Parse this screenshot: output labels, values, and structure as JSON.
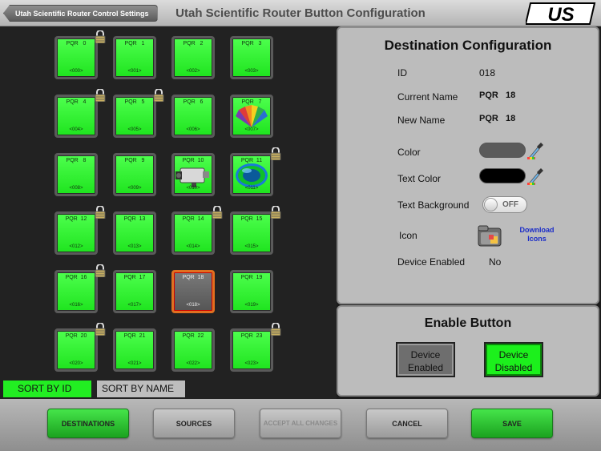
{
  "header": {
    "back_label": "Utah Scientific Router Control Settings",
    "title": "Utah Scientific Router Button Configuration",
    "logo_text": "US"
  },
  "tiles": [
    {
      "name": "PQR   0",
      "id": "<000>",
      "locked": true
    },
    {
      "name": "PQR   1",
      "id": "<001>",
      "locked": false
    },
    {
      "name": "PQR   2",
      "id": "<002>",
      "locked": false
    },
    {
      "name": "PQR   3",
      "id": "<003>",
      "locked": false
    },
    {
      "name": "PQR   4",
      "id": "<004>",
      "locked": true
    },
    {
      "name": "PQR   5",
      "id": "<005>",
      "locked": true
    },
    {
      "name": "PQR   6",
      "id": "<006>",
      "locked": false
    },
    {
      "name": "PQR   7",
      "id": "<007>",
      "locked": false,
      "icon": "peacock-logo-icon"
    },
    {
      "name": "PQR   8",
      "id": "<008>",
      "locked": false
    },
    {
      "name": "PQR   9",
      "id": "<009>",
      "locked": false
    },
    {
      "name": "PQR  10",
      "id": "<010>",
      "locked": false,
      "icon": "camera-icon"
    },
    {
      "name": "PQR  11",
      "id": "<011>",
      "locked": true,
      "icon": "globe-icon"
    },
    {
      "name": "PQR  12",
      "id": "<012>",
      "locked": true
    },
    {
      "name": "PQR  13",
      "id": "<013>",
      "locked": false
    },
    {
      "name": "PQR  14",
      "id": "<014>",
      "locked": true
    },
    {
      "name": "PQR  15",
      "id": "<015>",
      "locked": true
    },
    {
      "name": "PQR  16",
      "id": "<016>",
      "locked": true
    },
    {
      "name": "PQR  17",
      "id": "<017>",
      "locked": false
    },
    {
      "name": "PQR  18",
      "id": "<018>",
      "locked": false,
      "selected": true
    },
    {
      "name": "PQR  19",
      "id": "<019>",
      "locked": false
    },
    {
      "name": "PQR  20",
      "id": "<020>",
      "locked": true
    },
    {
      "name": "PQR  21",
      "id": "<021>",
      "locked": false
    },
    {
      "name": "PQR  22",
      "id": "<022>",
      "locked": false
    },
    {
      "name": "PQR  23",
      "id": "<023>",
      "locked": true
    }
  ],
  "sort": {
    "by_id": "SORT BY ID",
    "by_name": "SORT BY NAME",
    "active": "id"
  },
  "destination": {
    "title": "Destination Configuration",
    "id_label": "ID",
    "id_value": "018",
    "current_name_label": "Current Name",
    "current_name_value": "PQR   18",
    "new_name_label": "New Name",
    "new_name_value": "PQR   18",
    "color_label": "Color",
    "color_value": "#5a5a5a",
    "text_color_label": "Text Color",
    "text_color_value": "#000000",
    "text_bg_label": "Text Background",
    "text_bg_toggle": "OFF",
    "icon_label": "Icon",
    "download_icons": "Download Icons",
    "device_enabled_label": "Device Enabled",
    "device_enabled_value": "No"
  },
  "enable": {
    "title": "Enable Button",
    "enabled_label": "Device Enabled",
    "disabled_label": "Device Disabled"
  },
  "toolbar": {
    "destinations": "DESTINATIONS",
    "sources": "SOURCES",
    "accept_all": "ACCEPT ALL CHANGES",
    "cancel": "CANCEL",
    "save": "SAVE"
  },
  "colors": {
    "accent_green": "#22ee22",
    "selection_border": "#e07020"
  }
}
